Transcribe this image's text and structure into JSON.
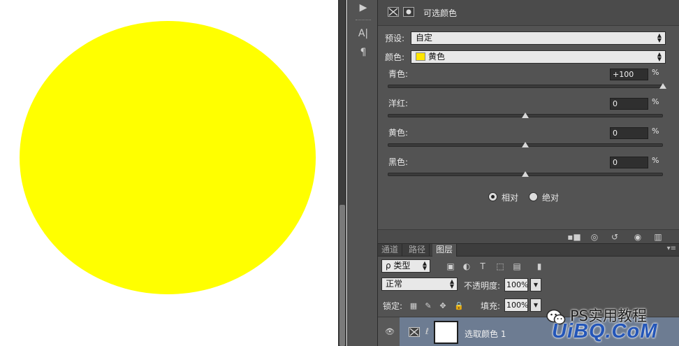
{
  "colors": {
    "yellow": "#ffff00",
    "swatch": "#ffe600",
    "selected_layer": "#6d7c92"
  },
  "tool_strip": {
    "icons": [
      "play-icon",
      "text-tool-icon",
      "paragraph-icon"
    ],
    "text_tool_glyph": "A|",
    "paragraph_glyph": "¶",
    "play_glyph": "▶"
  },
  "properties": {
    "title": "可选颜色",
    "preset_label": "预设:",
    "preset_value": "自定",
    "color_label": "颜色:",
    "color_value": "黄色",
    "sliders": [
      {
        "label": "青色:",
        "value": "+100",
        "unit": "%",
        "level": 1.0
      },
      {
        "label": "洋红:",
        "value": "0",
        "unit": "%",
        "level": 0.5
      },
      {
        "label": "黄色:",
        "value": "0",
        "unit": "%",
        "level": 0.5
      },
      {
        "label": "黑色:",
        "value": "0",
        "unit": "%",
        "level": 0.5
      }
    ],
    "method": {
      "relative_label": "相对",
      "absolute_label": "绝对",
      "selected": "relative"
    },
    "footer_icons": [
      "clip-to-layer-icon",
      "view-previous-icon",
      "reset-icon",
      "visibility-icon",
      "delete-icon"
    ]
  },
  "layers": {
    "tabs": [
      {
        "label": "通道",
        "active": false
      },
      {
        "label": "路径",
        "active": false
      },
      {
        "label": "图层",
        "active": true
      }
    ],
    "filter_kind": "ρ 类型",
    "blend_mode": "正常",
    "opacity_label": "不透明度:",
    "opacity_value": "100%",
    "lock_label": "锁定:",
    "fill_label": "填充:",
    "fill_value": "100%",
    "layer_name": "选取颜色 1"
  },
  "watermark": {
    "line1": "PS实用教程",
    "line2": "UiBQ.CoM"
  }
}
